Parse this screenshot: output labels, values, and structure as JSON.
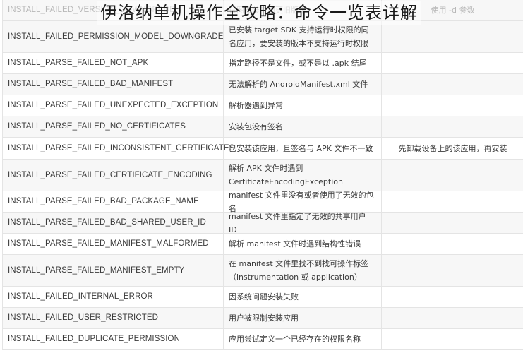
{
  "title": "伊洛纳单机操作全攻略：命令一览表详解",
  "rows": [
    {
      "code": "INSTALL_FAILED_VERSION_DOWNGRADE",
      "desc": "试图安装应用更旧版本",
      "solution": "使用 -d 参数"
    },
    {
      "code": "INSTALL_FAILED_PERMISSION_MODEL_DOWNGRADE",
      "desc": "已安装 target SDK 支持运行时权限的同名应用，要安装的版本不支持运行时权限",
      "solution": ""
    },
    {
      "code": "INSTALL_PARSE_FAILED_NOT_APK",
      "desc": "指定路径不是文件，或不是以 .apk 结尾",
      "solution": ""
    },
    {
      "code": "INSTALL_PARSE_FAILED_BAD_MANIFEST",
      "desc": "无法解析的 AndroidManifest.xml 文件",
      "solution": ""
    },
    {
      "code": "INSTALL_PARSE_FAILED_UNEXPECTED_EXCEPTION",
      "desc": "解析器遇到异常",
      "solution": ""
    },
    {
      "code": "INSTALL_PARSE_FAILED_NO_CERTIFICATES",
      "desc": "安装包没有签名",
      "solution": ""
    },
    {
      "code": "INSTALL_PARSE_FAILED_INCONSISTENT_CERTIFICATES",
      "desc": "已安装该应用，且签名与 APK 文件不一致",
      "solution": "先卸载设备上的该应用，再安装"
    },
    {
      "code": "INSTALL_PARSE_FAILED_CERTIFICATE_ENCODING",
      "desc": "解析 APK 文件时遇到 CertificateEncodingException",
      "solution": ""
    },
    {
      "code": "INSTALL_PARSE_FAILED_BAD_PACKAGE_NAME",
      "desc": "manifest 文件里没有或者使用了无效的包名",
      "solution": ""
    },
    {
      "code": "INSTALL_PARSE_FAILED_BAD_SHARED_USER_ID",
      "desc": "manifest 文件里指定了无效的共享用户 ID",
      "solution": ""
    },
    {
      "code": "INSTALL_PARSE_FAILED_MANIFEST_MALFORMED",
      "desc": "解析 manifest 文件时遇到结构性错误",
      "solution": ""
    },
    {
      "code": "INSTALL_PARSE_FAILED_MANIFEST_EMPTY",
      "desc": "在 manifest 文件里找不到找可操作标签（instrumentation 或 application）",
      "solution": ""
    },
    {
      "code": "INSTALL_FAILED_INTERNAL_ERROR",
      "desc": "因系统问题安装失败",
      "solution": ""
    },
    {
      "code": "INSTALL_FAILED_USER_RESTRICTED",
      "desc": "用户被限制安装应用",
      "solution": ""
    },
    {
      "code": "INSTALL_FAILED_DUPLICATE_PERMISSION",
      "desc": "应用尝试定义一个已经存在的权限名称",
      "solution": ""
    }
  ]
}
